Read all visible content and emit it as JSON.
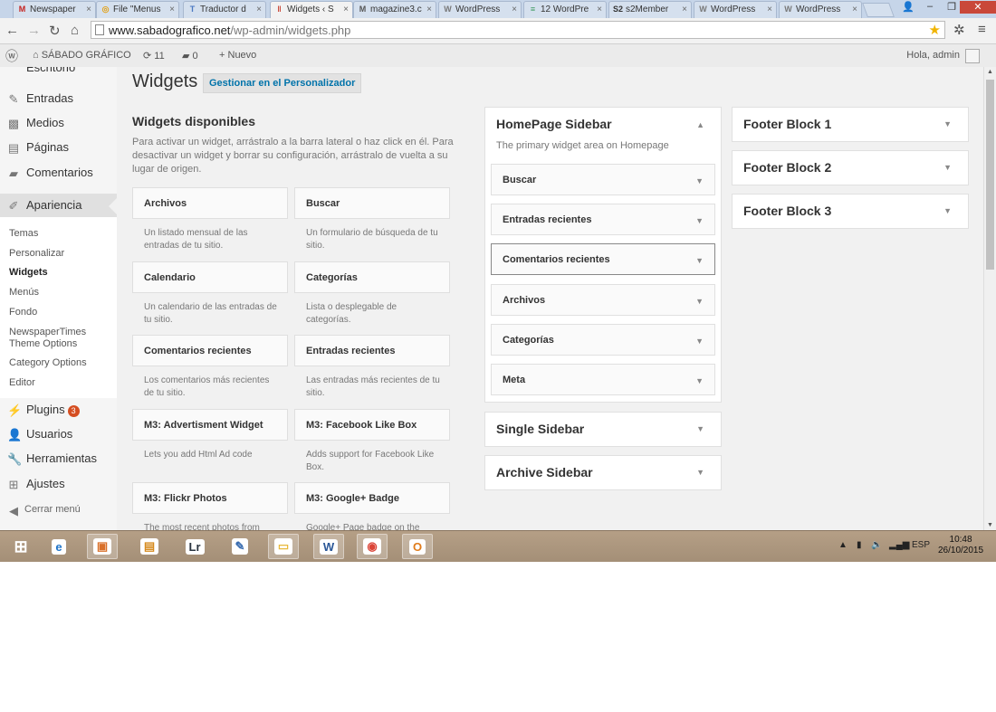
{
  "browser": {
    "tabs": [
      {
        "icon": "gmail-icon",
        "label": "Newspaper",
        "fav": "M",
        "color": "#c5221f"
      },
      {
        "icon": "file-icon",
        "label": "File \"Menus",
        "fav": "◎",
        "color": "#e3a21a"
      },
      {
        "icon": "translate-icon",
        "label": "Traductor d",
        "fav": "T",
        "color": "#4a78c2"
      },
      {
        "icon": "widgets-icon",
        "label": "Widgets ‹ S",
        "fav": "‖",
        "color": "#c9483a"
      },
      {
        "icon": "gmail-icon",
        "label": "magazine3.c",
        "fav": "M",
        "color": "#555"
      },
      {
        "icon": "wordpress-icon",
        "label": "WordPress",
        "fav": "W",
        "color": "#777"
      },
      {
        "icon": "list-icon",
        "label": "12 WordPre",
        "fav": "≡",
        "color": "#3c9a5f"
      },
      {
        "icon": "s2member-icon",
        "label": "s2Member",
        "fav": "S2",
        "color": "#333"
      },
      {
        "icon": "wordpress-icon",
        "label": "WordPress",
        "fav": "W",
        "color": "#777"
      },
      {
        "icon": "wordpress-icon",
        "label": "WordPress",
        "fav": "W",
        "color": "#777"
      }
    ],
    "url_host": "www.sabadografico.net",
    "url_path": "/wp-admin/widgets.php"
  },
  "adminbar": {
    "site_name": "SÁBADO GRÁFICO",
    "updates": "11",
    "comments": "0",
    "new_label": "Nuevo",
    "greeting": "Hola, admin"
  },
  "sidebar": {
    "cut_item": "Escritorio",
    "items_top": [
      {
        "label": "Entradas",
        "icon": "pin-icon"
      },
      {
        "label": "Medios",
        "icon": "media-icon"
      },
      {
        "label": "Páginas",
        "icon": "page-icon"
      },
      {
        "label": "Comentarios",
        "icon": "comment-icon"
      }
    ],
    "current": "Apariencia",
    "submenu": [
      "Temas",
      "Personalizar",
      "Widgets",
      "Menús",
      "Fondo",
      "NewspaperTimes Theme Options",
      "Category Options",
      "Editor"
    ],
    "items_bottom": [
      {
        "label": "Plugins",
        "icon": "plugin-icon",
        "badge": "3"
      },
      {
        "label": "Usuarios",
        "icon": "users-icon",
        "badge": ""
      },
      {
        "label": "Herramientas",
        "icon": "tools-icon",
        "badge": ""
      },
      {
        "label": "Ajustes",
        "icon": "settings-icon",
        "badge": ""
      }
    ],
    "collapse": "Cerrar menú"
  },
  "main": {
    "title": "Widgets",
    "manage_button": "Gestionar en el Personalizador",
    "available_title": "Widgets disponibles",
    "available_desc": "Para activar un widget, arrástralo a la barra lateral o haz click en él. Para desactivar un widget y borrar su configuración, arrástralo de vuelta a su lugar de origen.",
    "widgets": [
      {
        "title": "Archivos",
        "desc": "Un listado mensual de las entradas de tu sitio."
      },
      {
        "title": "Buscar",
        "desc": "Un formulario de búsqueda de tu sitio."
      },
      {
        "title": "Calendario",
        "desc": "Un calendario de las entradas de tu sitio."
      },
      {
        "title": "Categorías",
        "desc": "Lista o desplegable de categorías."
      },
      {
        "title": "Comentarios recientes",
        "desc": "Los comentarios más recientes de tu sitio."
      },
      {
        "title": "Entradas recientes",
        "desc": "Las entradas más recientes de tu sitio."
      },
      {
        "title": "M3: Advertisment Widget",
        "desc": "Lets you add Html Ad code"
      },
      {
        "title": "M3: Facebook Like Box",
        "desc": "Adds support for Facebook Like Box."
      },
      {
        "title": "M3: Flickr Photos",
        "desc": "The most recent photos from"
      },
      {
        "title": "M3: Google+ Badge",
        "desc": "Google+ Page badge on the"
      }
    ],
    "homepage_sidebar": {
      "title": "HomePage Sidebar",
      "desc": "The primary widget area on Homepage",
      "widgets": [
        "Buscar",
        "Entradas recientes",
        "Comentarios recientes",
        "Archivos",
        "Categorías",
        "Meta"
      ]
    },
    "other_sidebars": [
      "Single Sidebar",
      "Archive Sidebar"
    ],
    "footer_blocks": [
      "Footer Block 1",
      "Footer Block 2",
      "Footer Block 3"
    ]
  },
  "taskbar": {
    "apps": [
      {
        "icon": "ie-icon",
        "glyph": "e",
        "color": "#1e73c8"
      },
      {
        "icon": "app-icon",
        "glyph": "▣",
        "color": "#d9702a"
      },
      {
        "icon": "notes-icon",
        "glyph": "▤",
        "color": "#d68a1d"
      },
      {
        "icon": "lightroom-icon",
        "glyph": "Lr",
        "color": "#2a3440"
      },
      {
        "icon": "feather-icon",
        "glyph": "✎",
        "color": "#3a6db0"
      },
      {
        "icon": "explorer-icon",
        "glyph": "▭",
        "color": "#e8b93b"
      },
      {
        "icon": "word-icon",
        "glyph": "W",
        "color": "#2b5797"
      },
      {
        "icon": "chrome-icon",
        "glyph": "◉",
        "color": "#db4437"
      },
      {
        "icon": "outlook-icon",
        "glyph": "O",
        "color": "#e07b1a"
      }
    ],
    "language": "ESP",
    "time": "10:48",
    "date": "26/10/2015"
  }
}
